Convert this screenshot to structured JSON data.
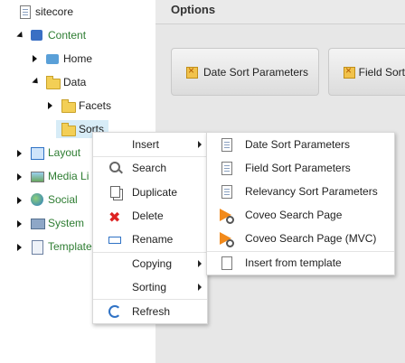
{
  "tree": {
    "root": "sitecore",
    "items": [
      {
        "key": "content",
        "label": "Content",
        "icon": "content-cube-icon"
      },
      {
        "key": "home",
        "label": "Home",
        "icon": "home-icon"
      },
      {
        "key": "data",
        "label": "Data",
        "icon": "folder-icon"
      },
      {
        "key": "facets",
        "label": "Facets",
        "icon": "folder-icon"
      },
      {
        "key": "sorts",
        "label": "Sorts",
        "icon": "folder-icon"
      },
      {
        "key": "layout",
        "label": "Layout",
        "icon": "layout-icon"
      },
      {
        "key": "media",
        "label": "Media Li",
        "icon": "media-library-icon"
      },
      {
        "key": "social",
        "label": "Social",
        "icon": "globe-icon"
      },
      {
        "key": "system",
        "label": "System",
        "icon": "system-icon"
      },
      {
        "key": "templates",
        "label": "Template",
        "icon": "template-icon"
      }
    ]
  },
  "options": {
    "title": "Options",
    "buttons": [
      "Date Sort Parameters",
      "Field Sort"
    ]
  },
  "context_menu": {
    "items": [
      {
        "label": "Insert",
        "icon": "",
        "submenu": true
      },
      {
        "label": "Search",
        "icon": "search-icon",
        "submenu": false
      },
      {
        "label": "Duplicate",
        "icon": "duplicate-icon",
        "submenu": false
      },
      {
        "label": "Delete",
        "icon": "delete-icon",
        "submenu": false
      },
      {
        "label": "Rename",
        "icon": "rename-icon",
        "submenu": false
      },
      {
        "label": "Copying",
        "icon": "",
        "submenu": true
      },
      {
        "label": "Sorting",
        "icon": "",
        "submenu": true
      },
      {
        "label": "Refresh",
        "icon": "refresh-icon",
        "submenu": false
      }
    ]
  },
  "insert_menu": {
    "items": [
      {
        "label": "Date Sort Parameters",
        "icon": "sort-parameters-icon"
      },
      {
        "label": "Field Sort Parameters",
        "icon": "sort-parameters-icon"
      },
      {
        "label": "Relevancy Sort Parameters",
        "icon": "sort-parameters-icon"
      },
      {
        "label": "Coveo Search Page",
        "icon": "coveo-search-icon"
      },
      {
        "label": "Coveo Search Page (MVC)",
        "icon": "coveo-search-icon"
      },
      {
        "label": "Insert from template",
        "icon": "insert-from-template-icon"
      }
    ]
  },
  "colors": {
    "tree_text_green": "#2e7d32",
    "selection": "#d7ecf7",
    "panel_bg": "#e7e7e7"
  }
}
